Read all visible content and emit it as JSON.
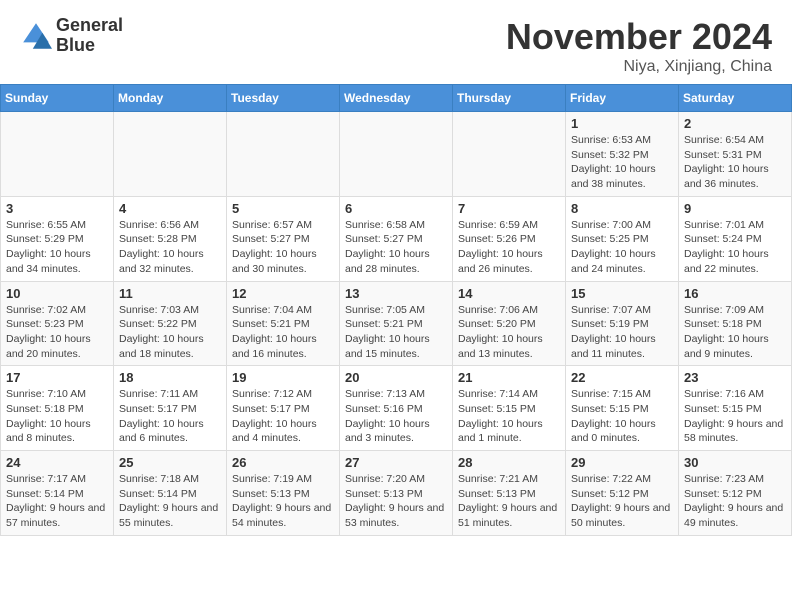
{
  "header": {
    "logo": {
      "general": "General",
      "blue": "Blue"
    },
    "month_title": "November 2024",
    "location": "Niya, Xinjiang, China"
  },
  "days_of_week": [
    "Sunday",
    "Monday",
    "Tuesday",
    "Wednesday",
    "Thursday",
    "Friday",
    "Saturday"
  ],
  "weeks": [
    [
      {
        "day": "",
        "info": ""
      },
      {
        "day": "",
        "info": ""
      },
      {
        "day": "",
        "info": ""
      },
      {
        "day": "",
        "info": ""
      },
      {
        "day": "",
        "info": ""
      },
      {
        "day": "1",
        "info": "Sunrise: 6:53 AM\nSunset: 5:32 PM\nDaylight: 10 hours and 38 minutes."
      },
      {
        "day": "2",
        "info": "Sunrise: 6:54 AM\nSunset: 5:31 PM\nDaylight: 10 hours and 36 minutes."
      }
    ],
    [
      {
        "day": "3",
        "info": "Sunrise: 6:55 AM\nSunset: 5:29 PM\nDaylight: 10 hours and 34 minutes."
      },
      {
        "day": "4",
        "info": "Sunrise: 6:56 AM\nSunset: 5:28 PM\nDaylight: 10 hours and 32 minutes."
      },
      {
        "day": "5",
        "info": "Sunrise: 6:57 AM\nSunset: 5:27 PM\nDaylight: 10 hours and 30 minutes."
      },
      {
        "day": "6",
        "info": "Sunrise: 6:58 AM\nSunset: 5:27 PM\nDaylight: 10 hours and 28 minutes."
      },
      {
        "day": "7",
        "info": "Sunrise: 6:59 AM\nSunset: 5:26 PM\nDaylight: 10 hours and 26 minutes."
      },
      {
        "day": "8",
        "info": "Sunrise: 7:00 AM\nSunset: 5:25 PM\nDaylight: 10 hours and 24 minutes."
      },
      {
        "day": "9",
        "info": "Sunrise: 7:01 AM\nSunset: 5:24 PM\nDaylight: 10 hours and 22 minutes."
      }
    ],
    [
      {
        "day": "10",
        "info": "Sunrise: 7:02 AM\nSunset: 5:23 PM\nDaylight: 10 hours and 20 minutes."
      },
      {
        "day": "11",
        "info": "Sunrise: 7:03 AM\nSunset: 5:22 PM\nDaylight: 10 hours and 18 minutes."
      },
      {
        "day": "12",
        "info": "Sunrise: 7:04 AM\nSunset: 5:21 PM\nDaylight: 10 hours and 16 minutes."
      },
      {
        "day": "13",
        "info": "Sunrise: 7:05 AM\nSunset: 5:21 PM\nDaylight: 10 hours and 15 minutes."
      },
      {
        "day": "14",
        "info": "Sunrise: 7:06 AM\nSunset: 5:20 PM\nDaylight: 10 hours and 13 minutes."
      },
      {
        "day": "15",
        "info": "Sunrise: 7:07 AM\nSunset: 5:19 PM\nDaylight: 10 hours and 11 minutes."
      },
      {
        "day": "16",
        "info": "Sunrise: 7:09 AM\nSunset: 5:18 PM\nDaylight: 10 hours and 9 minutes."
      }
    ],
    [
      {
        "day": "17",
        "info": "Sunrise: 7:10 AM\nSunset: 5:18 PM\nDaylight: 10 hours and 8 minutes."
      },
      {
        "day": "18",
        "info": "Sunrise: 7:11 AM\nSunset: 5:17 PM\nDaylight: 10 hours and 6 minutes."
      },
      {
        "day": "19",
        "info": "Sunrise: 7:12 AM\nSunset: 5:17 PM\nDaylight: 10 hours and 4 minutes."
      },
      {
        "day": "20",
        "info": "Sunrise: 7:13 AM\nSunset: 5:16 PM\nDaylight: 10 hours and 3 minutes."
      },
      {
        "day": "21",
        "info": "Sunrise: 7:14 AM\nSunset: 5:15 PM\nDaylight: 10 hours and 1 minute."
      },
      {
        "day": "22",
        "info": "Sunrise: 7:15 AM\nSunset: 5:15 PM\nDaylight: 10 hours and 0 minutes."
      },
      {
        "day": "23",
        "info": "Sunrise: 7:16 AM\nSunset: 5:15 PM\nDaylight: 9 hours and 58 minutes."
      }
    ],
    [
      {
        "day": "24",
        "info": "Sunrise: 7:17 AM\nSunset: 5:14 PM\nDaylight: 9 hours and 57 minutes."
      },
      {
        "day": "25",
        "info": "Sunrise: 7:18 AM\nSunset: 5:14 PM\nDaylight: 9 hours and 55 minutes."
      },
      {
        "day": "26",
        "info": "Sunrise: 7:19 AM\nSunset: 5:13 PM\nDaylight: 9 hours and 54 minutes."
      },
      {
        "day": "27",
        "info": "Sunrise: 7:20 AM\nSunset: 5:13 PM\nDaylight: 9 hours and 53 minutes."
      },
      {
        "day": "28",
        "info": "Sunrise: 7:21 AM\nSunset: 5:13 PM\nDaylight: 9 hours and 51 minutes."
      },
      {
        "day": "29",
        "info": "Sunrise: 7:22 AM\nSunset: 5:12 PM\nDaylight: 9 hours and 50 minutes."
      },
      {
        "day": "30",
        "info": "Sunrise: 7:23 AM\nSunset: 5:12 PM\nDaylight: 9 hours and 49 minutes."
      }
    ]
  ]
}
